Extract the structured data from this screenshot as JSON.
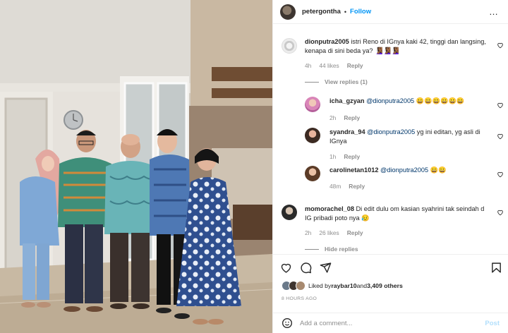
{
  "post": {
    "username": "petergontha",
    "separator": "•",
    "follow_label": "Follow",
    "more_label": "…"
  },
  "comments": [
    {
      "user": "dionputra2005",
      "text": "istri Reno di IGnya kaki 42, tinggi dan langsing, kenapa di sini beda ya? 🧏🏾‍♀️🧏🏾‍♀️🧏🏾‍♀️",
      "text_line1": "istri Reno di IGnya kaki 42, tinggi dan langsing,",
      "text_line2": "kenapa di sini beda ya? 🧏🏾‍♀️🧏🏾‍♀️🧏🏾‍♀️",
      "time": "4h",
      "likes": "44 likes",
      "reply": "Reply",
      "view_replies": "View replies (1)"
    }
  ],
  "replies": [
    {
      "user": "icha_gzyan",
      "mention": "@dionputra2005",
      "text": "😀😀😀😀😀😀",
      "time": "2h",
      "reply": "Reply"
    },
    {
      "user": "syandra_94",
      "mention": "@dionputra2005",
      "text_line1": "yg ini editan, yg asli di",
      "text_line2": "IGnya",
      "time": "1h",
      "reply": "Reply"
    },
    {
      "user": "carolinetan1012",
      "mention": "@dionputra2005",
      "text": "😀😀",
      "time": "48m",
      "reply": "Reply"
    }
  ],
  "comment2": {
    "user": "momorachel_08",
    "text_line1": "Di edit dulu om kasian syahrini tak seindah d",
    "text_line2": "IG pribadi poto nya 😥",
    "time": "2h",
    "likes": "26 likes",
    "reply": "Reply",
    "hide_replies": "Hide replies"
  },
  "actions": {
    "like_icon": "heart-icon",
    "comment_icon": "comment-icon",
    "share_icon": "paper-plane-icon",
    "save_icon": "bookmark-icon"
  },
  "likes_summary": {
    "prefix": "Liked by ",
    "user": "raybar10",
    "middle": " and ",
    "others": "3,409 others"
  },
  "time_ago": "8 HOURS AGO",
  "add_comment": {
    "placeholder": "Add a comment...",
    "post_label": "Post"
  },
  "colors": {
    "accent": "#0095f6",
    "post_disabled": "#b2dffc",
    "muted": "#8e8e8e",
    "mention": "#00376b"
  }
}
